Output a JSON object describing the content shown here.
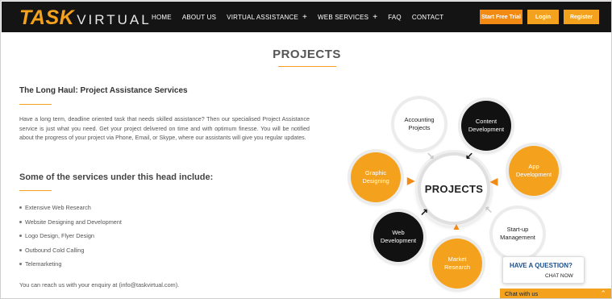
{
  "header": {
    "logo_task": "TASK",
    "logo_virtual": "VIRTUAL",
    "nav": [
      {
        "label": "HOME",
        "plus": ""
      },
      {
        "label": "ABOUT US",
        "plus": ""
      },
      {
        "label": "VIRTUAL ASSISTANCE",
        "plus": "+"
      },
      {
        "label": "WEB SERVICES",
        "plus": "+"
      },
      {
        "label": "FAQ",
        "plus": ""
      },
      {
        "label": "CONTACT",
        "plus": ""
      }
    ],
    "trial_label": "Start Free Trial",
    "login_label": "Login",
    "register_label": "Register"
  },
  "main": {
    "title": "PROJECTS",
    "heading": "The Long Haul: Project Assistance Services",
    "paragraph": "Have a long term, deadline oriented task that needs skilled assistance? Then our specialised Project Assistance service is just what you need. Get your project delivered on time and with optimum finesse. You will be notified about the progress of your project via Phone, Email, or Skype, where our assistants will give you regular updates.",
    "services_heading": "Some of the services under this head include:",
    "services": [
      "Extensive Web Research",
      "Website Designing and Development",
      "Logo Design, Flyer Design",
      "Outbound Cold Calling",
      "Telemarketing"
    ],
    "contact": "You can reach us with your enquiry at (info@taskvirtual.com)."
  },
  "diagram": {
    "center": "PROJECTS",
    "nodes": {
      "accounting": "Accounting Projects",
      "content": "Content Development",
      "app": "App Development",
      "startup": "Start-up Management",
      "market": "Market Research",
      "web": "Web Development",
      "graphic": "Graphic Designing"
    }
  },
  "chat": {
    "question": "HAVE A QUESTION?",
    "now": "CHAT NOW",
    "bar_label": "Chat with us"
  },
  "colors": {
    "accent": "#f4a21d",
    "topbar": "#141414",
    "chat_blue": "#1e4f8a"
  }
}
